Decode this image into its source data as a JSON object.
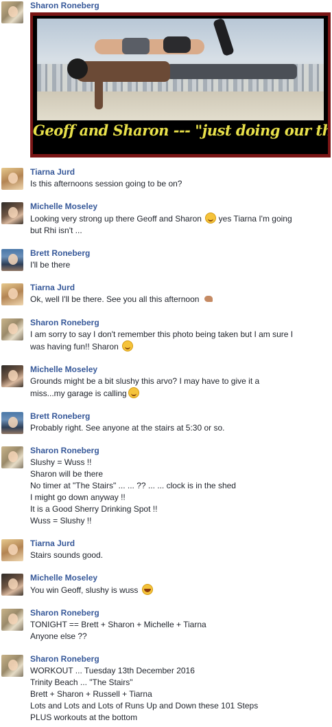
{
  "colors": {
    "name_link": "#365899",
    "text": "#1d2129",
    "photo_frame": "#7a1515",
    "caption": "#e8e04a"
  },
  "comments": [
    {
      "author": "Sharon Roneberg",
      "avatar": "sharon-avatar",
      "photo_caption": "Geoff and Sharon --- \"just doing our thing\""
    },
    {
      "author": "Tiarna Jurd",
      "avatar": "tiarna-avatar",
      "lines": [
        "Is this afternoons session going to be on?"
      ]
    },
    {
      "author": "Michelle Moseley",
      "avatar": "michelle-avatar",
      "lines": [
        "Looking very strong up there Geoff and Sharon",
        "yes Tiarna I'm going",
        "but Rhi isn't ..."
      ],
      "emoji": "smiling-face-icon"
    },
    {
      "author": "Brett Roneberg",
      "avatar": "brett-avatar",
      "lines": [
        "I'll be there"
      ]
    },
    {
      "author": "Tiarna Jurd",
      "avatar": "tiarna-avatar",
      "lines": [
        "Ok, well I'll be there. See you all this afternoon"
      ],
      "emoji": "flexed-biceps-icon"
    },
    {
      "author": "Sharon Roneberg",
      "avatar": "sharon-avatar",
      "lines": [
        "I am sorry to say I don't remember this photo being taken but I am sure I",
        "was having fun!! Sharon"
      ],
      "emoji": "smiling-face-icon"
    },
    {
      "author": "Michelle Moseley",
      "avatar": "michelle-avatar",
      "lines": [
        "Grounds might be a bit slushy this arvo? I may have to give it a",
        "miss...my garage is calling"
      ],
      "emoji": "smiling-face-icon"
    },
    {
      "author": "Brett Roneberg",
      "avatar": "brett-avatar",
      "lines": [
        "Probably right. See anyone at the stairs at 5:30 or so."
      ]
    },
    {
      "author": "Sharon Roneberg",
      "avatar": "sharon-avatar",
      "lines": [
        "Slushy = Wuss !!",
        "Sharon will be there",
        "No timer at \"The Stairs\" ... ... ?? ... ... clock is in the shed",
        "I might go down anyway !!",
        "It is a Good Sherry Drinking Spot !!",
        "Wuss = Slushy !!"
      ]
    },
    {
      "author": "Tiarna Jurd",
      "avatar": "tiarna-avatar",
      "lines": [
        "Stairs sounds good."
      ]
    },
    {
      "author": "Michelle Moseley",
      "avatar": "michelle-avatar",
      "lines": [
        "You win Geoff, slushy is wuss"
      ],
      "emoji": "laughing-face-icon"
    },
    {
      "author": "Sharon Roneberg",
      "avatar": "sharon-avatar",
      "lines": [
        "TONIGHT == Brett + Sharon + Michelle + Tiarna",
        "Anyone else ??"
      ]
    },
    {
      "author": "Sharon Roneberg",
      "avatar": "sharon-avatar",
      "lines": [
        "WORKOUT ... Tuesday 13th December 2016",
        "Trinity Beach ... \"The Stairs\"",
        "Brett + Sharon + Russell + Tiarna",
        "Lots and Lots and Lots of Runs Up and Down these 101 Steps",
        "PLUS workouts at the bottom"
      ]
    }
  ]
}
